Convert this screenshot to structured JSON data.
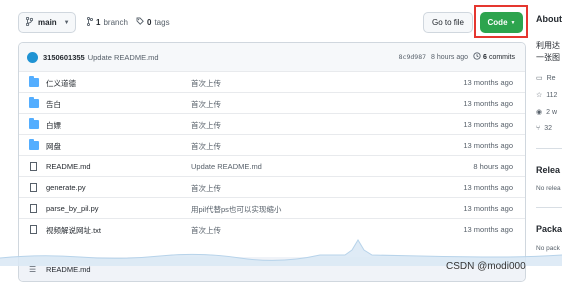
{
  "repo_bar": {
    "branch": "main",
    "branches": "1",
    "branches_label": "branch",
    "tags": "0",
    "tags_label": "tags",
    "go_to_file": "Go to file",
    "code": "Code"
  },
  "latest_commit": {
    "user": "3150601355",
    "message": "Update README.md",
    "hash": "8c9d987",
    "time": "8 hours ago",
    "commit_count": "6",
    "commit_label": "commits"
  },
  "files": [
    {
      "type": "folder",
      "name": "仁义道德",
      "message": "首次上传",
      "age": "13 months ago"
    },
    {
      "type": "folder",
      "name": "告白",
      "message": "首次上传",
      "age": "13 months ago"
    },
    {
      "type": "folder",
      "name": "白嫖",
      "message": "首次上传",
      "age": "13 months ago"
    },
    {
      "type": "folder",
      "name": "网盘",
      "message": "首次上传",
      "age": "13 months ago"
    },
    {
      "type": "file",
      "name": "README.md",
      "message": "Update README.md",
      "age": "8 hours ago"
    },
    {
      "type": "file",
      "name": "generate.py",
      "message": "首次上传",
      "age": "13 months ago"
    },
    {
      "type": "file",
      "name": "parse_by_pil.py",
      "message": "用pil代替ps也可以实现缩小",
      "age": "13 months ago"
    },
    {
      "type": "file",
      "name": "视频解说网址.txt",
      "message": "首次上传",
      "age": "13 months ago"
    }
  ],
  "readme_bar": {
    "name": "README.md"
  },
  "sidebar": {
    "about": "About",
    "desc_line1": "利用达",
    "desc_line2": "一张图",
    "readme": "Re",
    "stars": "112",
    "watching": "2 w",
    "forks": "32",
    "releases": "Relea",
    "releases_sub": "No relea",
    "packages": "Packa",
    "packages_sub": "No pack"
  },
  "watermark": "CSDN @modi000"
}
